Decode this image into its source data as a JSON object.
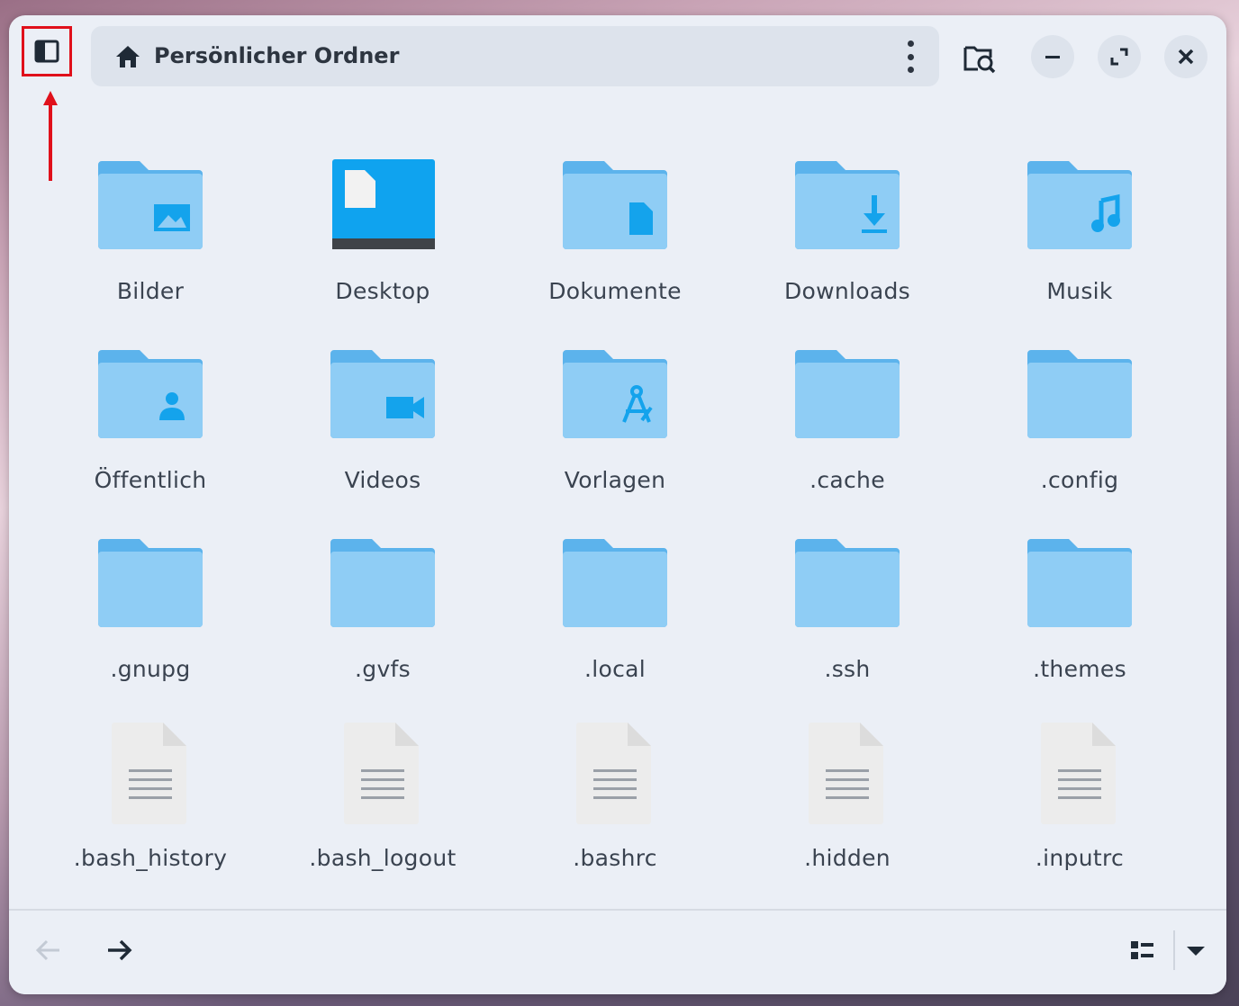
{
  "header": {
    "path_label": "Persönlicher Ordner"
  },
  "icons": {
    "sidebar_toggle": "sidebar-toggle-icon",
    "home": "home-icon",
    "menu": "vertical-dots-icon",
    "search": "search-folder-icon",
    "minimize": "minimize-icon",
    "maximize": "maximize-icon",
    "close": "close-icon",
    "back": "arrow-left-icon",
    "forward": "arrow-right-icon",
    "view": "list-view-icon",
    "view_dropdown": "chevron-down-icon"
  },
  "colors": {
    "accent_annotation": "#e0101b",
    "folder": "#8fcdf5",
    "folder_dark": "#5cb3ec",
    "folder_glyph": "#14a3ec",
    "desktop": "#0fa3ef"
  },
  "items": [
    {
      "label": "Bilder",
      "type": "folder",
      "glyph": "image"
    },
    {
      "label": "Desktop",
      "type": "desktop",
      "glyph": "desktop"
    },
    {
      "label": "Dokumente",
      "type": "folder",
      "glyph": "document"
    },
    {
      "label": "Downloads",
      "type": "folder",
      "glyph": "download"
    },
    {
      "label": "Musik",
      "type": "folder",
      "glyph": "music"
    },
    {
      "label": "Öffentlich",
      "type": "folder",
      "glyph": "person"
    },
    {
      "label": "Videos",
      "type": "folder",
      "glyph": "video"
    },
    {
      "label": "Vorlagen",
      "type": "folder",
      "glyph": "template"
    },
    {
      "label": ".cache",
      "type": "folder",
      "glyph": "none"
    },
    {
      "label": ".config",
      "type": "folder",
      "glyph": "none"
    },
    {
      "label": ".gnupg",
      "type": "folder",
      "glyph": "none"
    },
    {
      "label": ".gvfs",
      "type": "folder",
      "glyph": "none"
    },
    {
      "label": ".local",
      "type": "folder",
      "glyph": "none"
    },
    {
      "label": ".ssh",
      "type": "folder",
      "glyph": "none"
    },
    {
      "label": ".themes",
      "type": "folder",
      "glyph": "none"
    },
    {
      "label": ".bash_history",
      "type": "file",
      "glyph": "text"
    },
    {
      "label": ".bash_logout",
      "type": "file",
      "glyph": "text"
    },
    {
      "label": ".bashrc",
      "type": "file",
      "glyph": "text"
    },
    {
      "label": ".hidden",
      "type": "file",
      "glyph": "text"
    },
    {
      "label": ".inputrc",
      "type": "file",
      "glyph": "text"
    }
  ]
}
